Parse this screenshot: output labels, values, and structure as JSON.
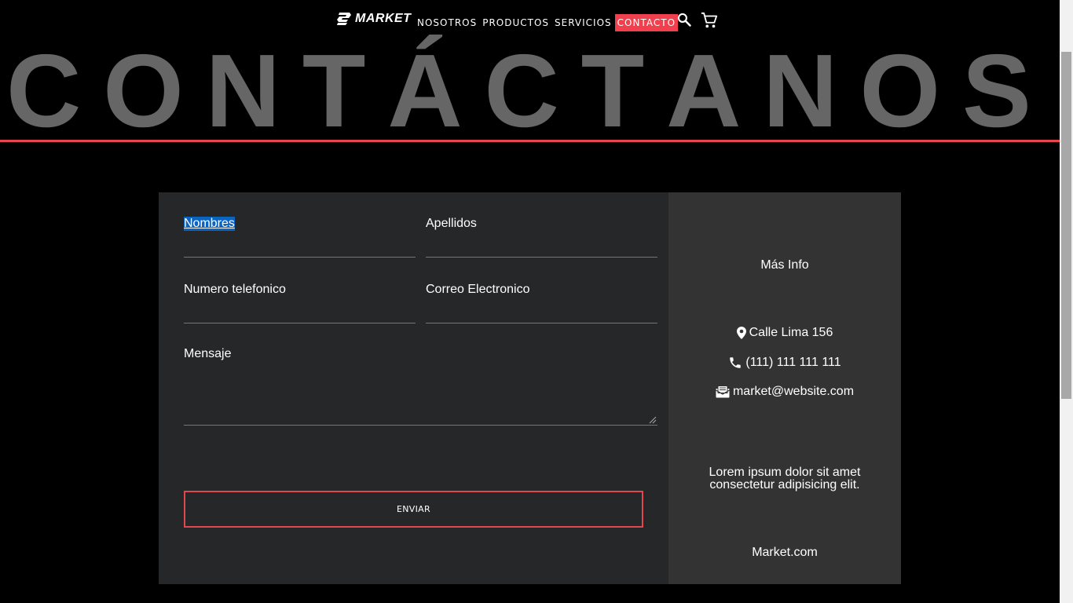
{
  "nav": {
    "logo_text": "MARKET",
    "links": [
      {
        "label": "NOSOTROS",
        "active": false
      },
      {
        "label": "PRODUCTOS",
        "active": false
      },
      {
        "label": "SERVICIOS",
        "active": false
      },
      {
        "label": "CONTACTO",
        "active": true
      }
    ],
    "icons": [
      "search-icon",
      "cart-icon"
    ]
  },
  "hero": {
    "title": "CONTÁCTANOS",
    "letters": [
      "C",
      "O",
      "N",
      "T",
      "Á",
      "C",
      "T",
      "A",
      "N",
      "O",
      "S"
    ]
  },
  "form": {
    "first_name_label": "Nombres",
    "last_name_label": "Apellidos",
    "phone_label": "Numero telefonico",
    "email_label": "Correo Electronico",
    "message_label": "Mensaje",
    "first_name_value": "",
    "last_name_value": "",
    "phone_value": "",
    "email_value": "",
    "message_value": "",
    "submit_label": "ENVIAR"
  },
  "info": {
    "title": "Más Info",
    "address": "Calle Lima 156",
    "phone": "(111) 111 111 111",
    "email": "market@website.com",
    "description": "Lorem ipsum dolor sit amet consectetur adipisicing elit.",
    "site": "Market.com"
  },
  "colors": {
    "accent": "#e2464f",
    "active_nav": "#f0404e",
    "hero_text": "#666666",
    "form_bg": "#262729",
    "info_bg": "#333334",
    "page_bg": "#000000"
  }
}
